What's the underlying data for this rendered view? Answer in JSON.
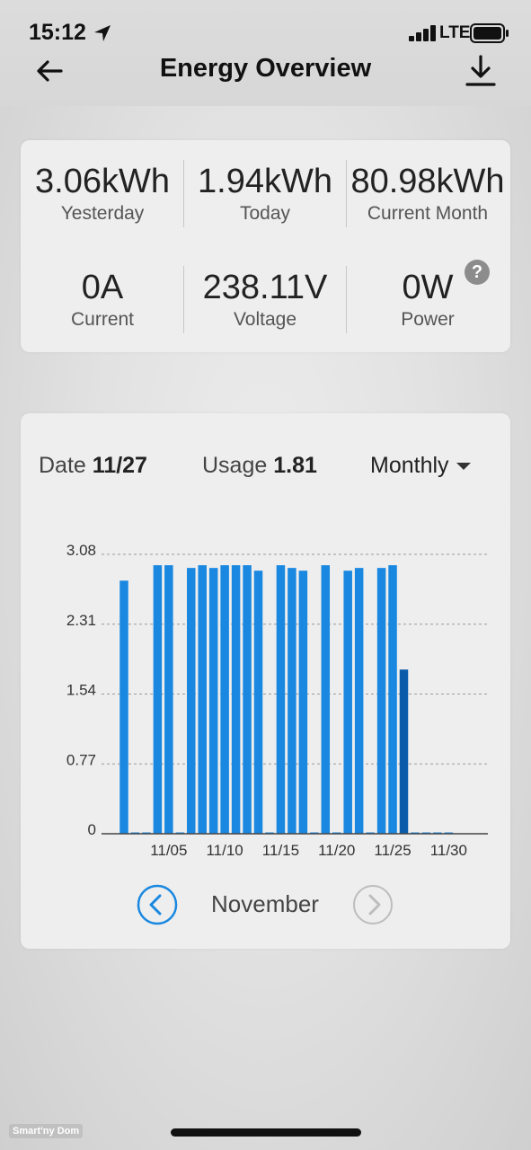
{
  "status_bar": {
    "time": "15:12",
    "network": "LTE"
  },
  "header": {
    "title": "Energy Overview"
  },
  "stats": [
    {
      "value": "3.06kWh",
      "label": "Yesterday"
    },
    {
      "value": "1.94kWh",
      "label": "Today"
    },
    {
      "value": "80.98kWh",
      "label": "Current Month"
    },
    {
      "value": "0A",
      "label": "Current"
    },
    {
      "value": "238.11V",
      "label": "Voltage"
    },
    {
      "value": "0W",
      "label": "Power"
    }
  ],
  "help_glyph": "?",
  "chart_panel": {
    "date_label": "Date",
    "date_value": "11/27",
    "usage_label": "Usage",
    "usage_value": "1.81",
    "period": "Monthly",
    "month": "November"
  },
  "chart_data": {
    "type": "bar",
    "x": [
      1,
      2,
      3,
      4,
      5,
      6,
      7,
      8,
      9,
      10,
      11,
      12,
      13,
      14,
      15,
      16,
      17,
      18,
      19,
      20,
      21,
      22,
      23,
      24,
      25,
      26,
      27,
      28,
      29,
      30
    ],
    "values": [
      2.79,
      0,
      0,
      2.96,
      2.96,
      0,
      2.93,
      2.96,
      2.93,
      2.96,
      2.96,
      2.96,
      2.9,
      0,
      2.96,
      2.93,
      2.9,
      0,
      2.96,
      0,
      2.9,
      2.93,
      0,
      2.93,
      2.96,
      1.81,
      0,
      0,
      0,
      0
    ],
    "selected_x": 26,
    "yticks": [
      "0",
      "0.77",
      "1.54",
      "2.31",
      "3.08"
    ],
    "ytick_values": [
      0,
      0.77,
      1.54,
      2.31,
      3.08
    ],
    "xticks": [
      "11/05",
      "11/10",
      "11/15",
      "11/20",
      "11/25",
      "11/30"
    ],
    "xtick_values": [
      5,
      10,
      15,
      20,
      25,
      30
    ],
    "ylim": [
      0,
      3.08
    ],
    "grid": true,
    "bar_color": "#1a88e0",
    "selected_color": "#0a5caa"
  },
  "watermark": "Smart'ny Dom"
}
